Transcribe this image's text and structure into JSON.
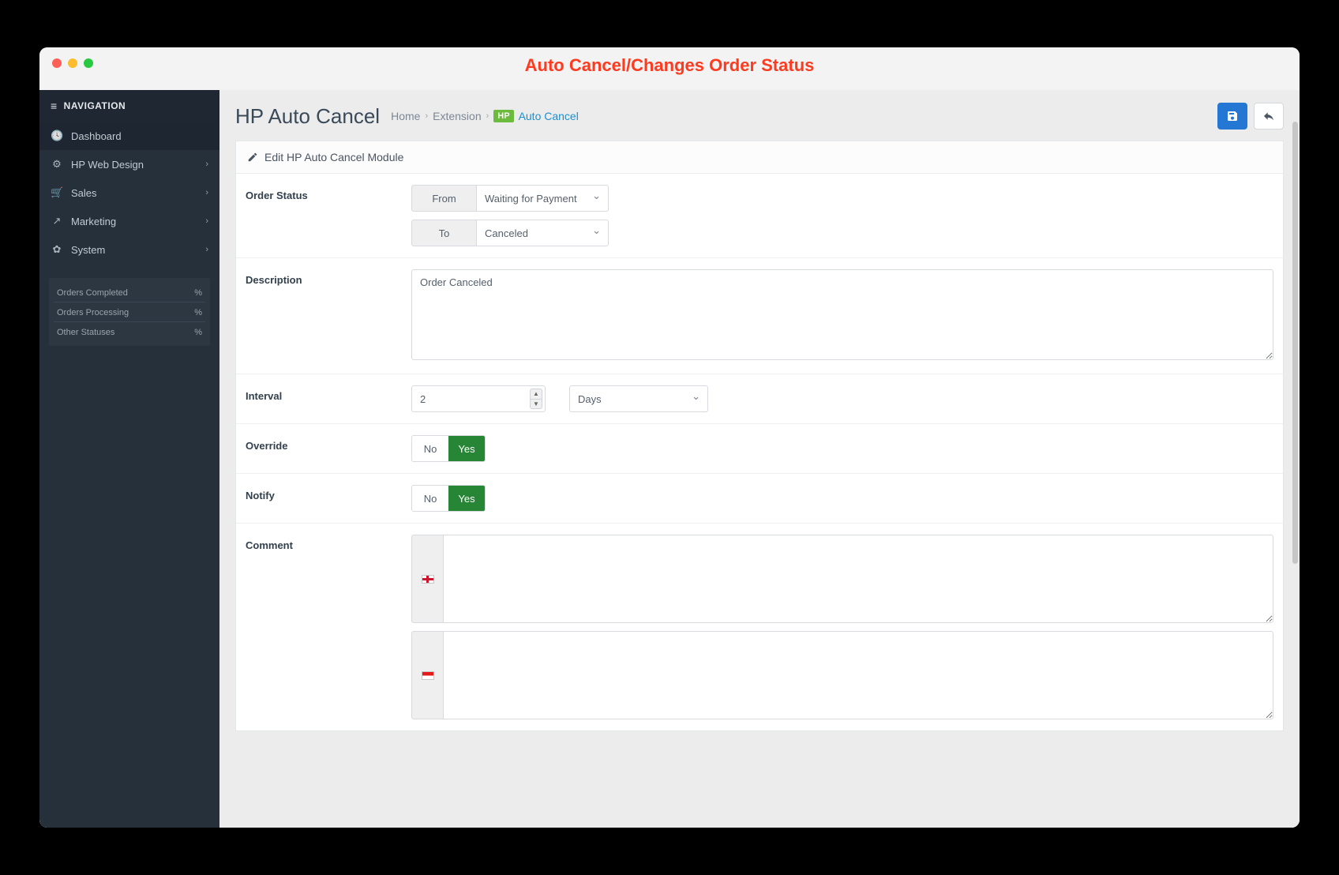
{
  "window": {
    "title": "Auto Cancel/Changes Order Status"
  },
  "sidebar": {
    "header": "NAVIGATION",
    "items": [
      {
        "icon": "dashboard",
        "label": "Dashboard",
        "active": true
      },
      {
        "icon": "cogs",
        "label": "HP Web Design",
        "hasSub": true
      },
      {
        "icon": "cart",
        "label": "Sales",
        "hasSub": true
      },
      {
        "icon": "share",
        "label": "Marketing",
        "hasSub": true
      },
      {
        "icon": "gear",
        "label": "System",
        "hasSub": true
      }
    ],
    "stats": [
      {
        "label": "Orders Completed",
        "value": "%"
      },
      {
        "label": "Orders Processing",
        "value": "%"
      },
      {
        "label": "Other Statuses",
        "value": "%"
      }
    ]
  },
  "page": {
    "title": "HP Auto Cancel",
    "breadcrumb": {
      "home": "Home",
      "ext": "Extension",
      "hp": "HP",
      "current": "Auto Cancel"
    },
    "panel_title": "Edit HP Auto Cancel Module"
  },
  "form": {
    "labels": {
      "order_status": "Order Status",
      "from": "From",
      "to": "To",
      "description": "Description",
      "interval": "Interval",
      "override": "Override",
      "notify": "Notify",
      "comment": "Comment",
      "no": "No",
      "yes": "Yes"
    },
    "order_status": {
      "from": "Waiting for Payment",
      "to": "Canceled"
    },
    "description": "Order Canceled",
    "interval": {
      "value": "2",
      "unit": "Days"
    },
    "override": "Yes",
    "notify": "Yes",
    "comment": {
      "en": "",
      "id": ""
    }
  }
}
